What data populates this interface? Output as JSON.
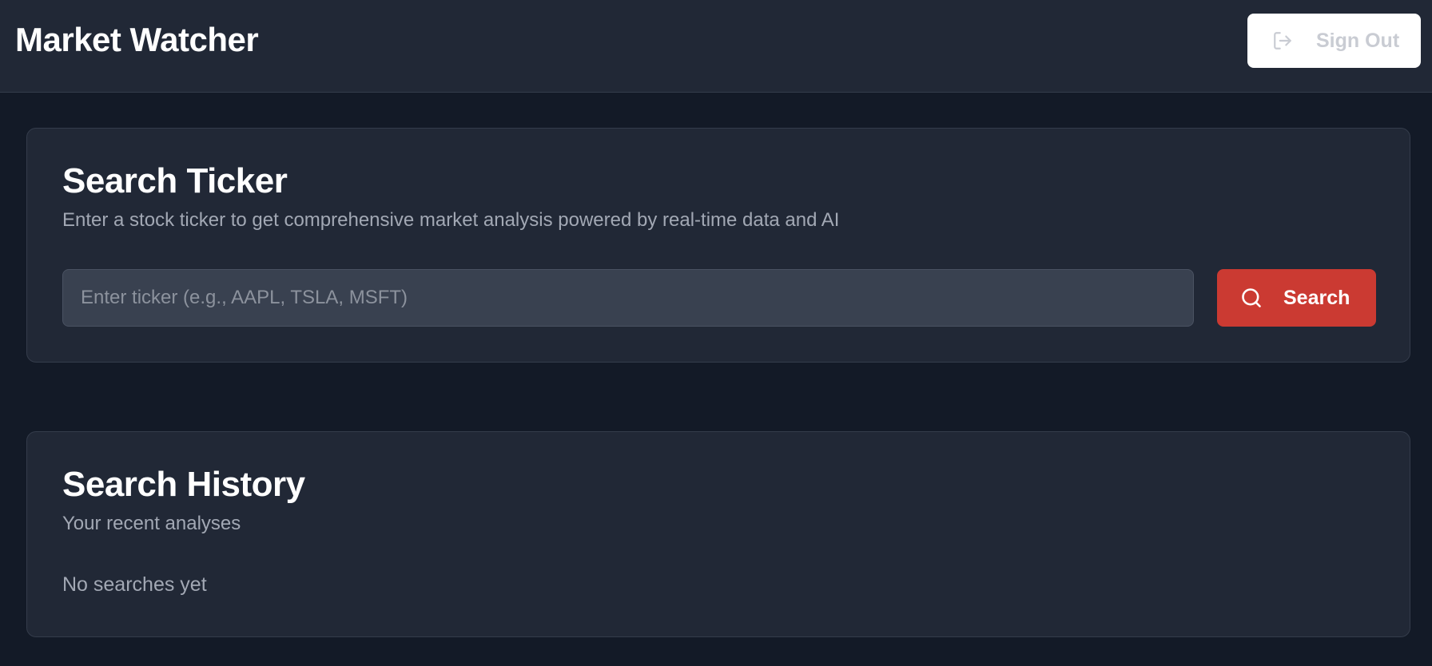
{
  "header": {
    "app_title": "Market Watcher",
    "sign_out_label": "Sign Out",
    "sign_out_icon": "sign-out-icon"
  },
  "search_card": {
    "title": "Search Ticker",
    "description": "Enter a stock ticker to get comprehensive market analysis powered by real-time data and AI",
    "input_placeholder": "Enter ticker (e.g., AAPL, TSLA, MSFT)",
    "input_value": "",
    "search_button_label": "Search",
    "search_icon": "search-icon"
  },
  "history_card": {
    "title": "Search History",
    "description": "Your recent analyses",
    "empty_message": "No searches yet"
  },
  "colors": {
    "background": "#131a27",
    "surface": "#212836",
    "accent": "#cb3a32",
    "input_bg": "#394150"
  }
}
